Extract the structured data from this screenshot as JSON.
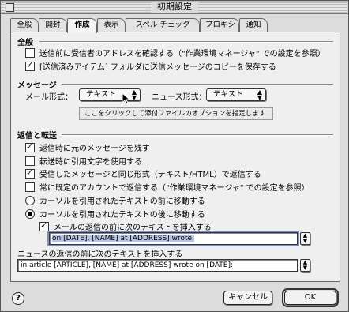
{
  "window": {
    "title": "初期設定"
  },
  "tabs": [
    {
      "label": "全般"
    },
    {
      "label": "開封"
    },
    {
      "label": "作成"
    },
    {
      "label": "表示"
    },
    {
      "label": "スペル チェック"
    },
    {
      "label": "プロキシ"
    },
    {
      "label": "通知"
    }
  ],
  "active_tab": "作成",
  "general": {
    "title": "全般",
    "options": [
      {
        "label": "送信前に受信者のアドレスを確認する（\"作業環境マネージャ\" での設定を参照）",
        "checked": false
      },
      {
        "label": "[送信済みアイテム] フォルダに送信メッセージのコピーを保存する",
        "checked": true
      }
    ]
  },
  "message": {
    "title": "メッセージ",
    "mail_format_label": "メール形式：",
    "mail_format_value": "テキスト",
    "news_format_label": "ニュース形式：",
    "news_format_value": "テキスト",
    "attachment_hint": "ここをクリックして添付ファイルのオプションを指定します"
  },
  "reply": {
    "title": "返信と転送",
    "options": [
      {
        "label": "返信時に元のメッセージを残す",
        "checked": true
      },
      {
        "label": "転送時に引用文字を使用する",
        "checked": false
      },
      {
        "label": "受信したメッセージと同じ形式（テキスト/HTML）で返信する",
        "checked": true
      },
      {
        "label": "常に既定のアカウントで返信する（\"作業環境マネージャ\" での設定を参照）",
        "checked": false
      }
    ],
    "radios": [
      {
        "label": "カーソルを引用されたテキストの前に移動する",
        "checked": false
      },
      {
        "label": "カーソルを引用されたテキストの後に移動する",
        "checked": true
      }
    ],
    "mail_insert": {
      "label": "メールの返信の前に次のテキストを挿入する",
      "checked": true
    },
    "mail_insert_text": "on [DATE], [NAME] at [ADDRESS] wrote:",
    "news_insert_label": "ニュースの返信の前に次のテキストを挿入する",
    "news_insert_text": "in article [ARTICLE], [NAME] at [ADDRESS] wrote on [DATE]:"
  },
  "buttons": {
    "help": "?",
    "cancel": "キャンセル",
    "ok": "OK"
  }
}
